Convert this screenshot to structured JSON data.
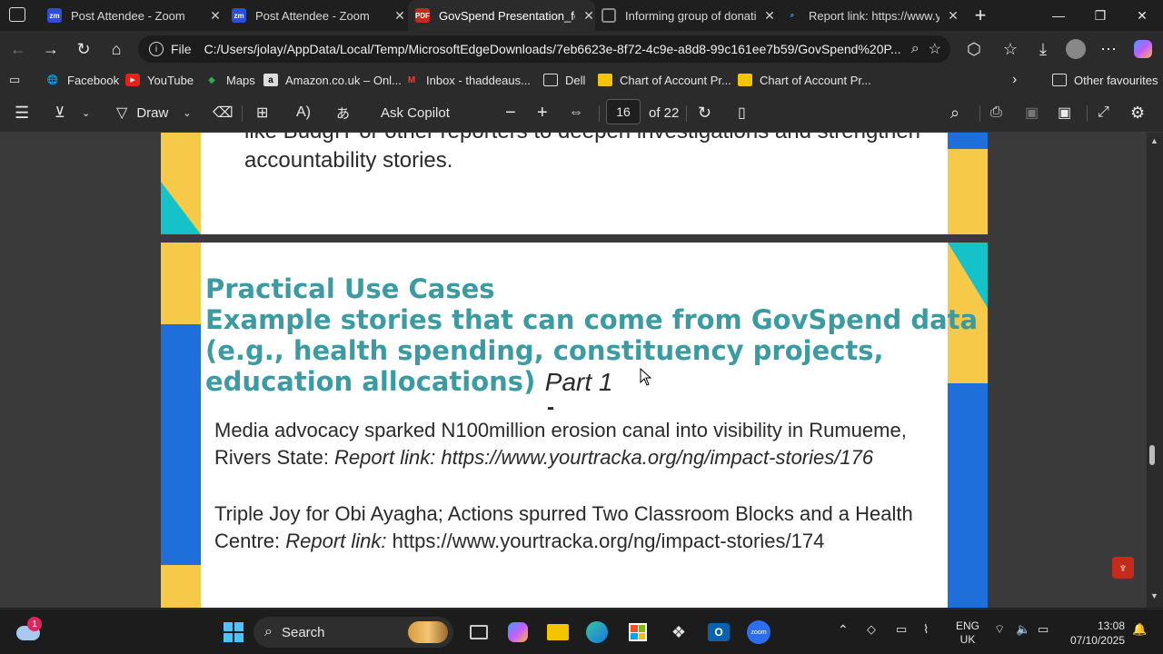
{
  "tabs": [
    {
      "label": "Post Attendee - Zoom",
      "icon": "zoom-icon",
      "active": false
    },
    {
      "label": "Post Attendee - Zoom",
      "icon": "zoom-icon",
      "active": false
    },
    {
      "label": "GovSpend Presentation_fc",
      "icon": "pdf-icon",
      "active": true
    },
    {
      "label": "Informing group of donati",
      "icon": "web-icon",
      "active": false
    },
    {
      "label": "Report link: https://www.yc",
      "icon": "search-icon",
      "active": false
    }
  ],
  "address": {
    "label": "File",
    "url": "C:/Users/jolay/AppData/Local/Temp/MicrosoftEdgeDownloads/7eb6623e-8f72-4c9e-a8d8-99c161ee7b59/GovSpend%20P..."
  },
  "favorites": [
    {
      "label": "Facebook",
      "icon": "facebook-icon"
    },
    {
      "label": "YouTube",
      "icon": "youtube-icon"
    },
    {
      "label": "Maps",
      "icon": "maps-icon"
    },
    {
      "label": "Amazon.co.uk – Onl...",
      "icon": "amazon-icon"
    },
    {
      "label": "Inbox - thaddeaus...",
      "icon": "gmail-icon"
    },
    {
      "label": "Dell",
      "icon": "folder-icon"
    },
    {
      "label": "Chart of Account Pr...",
      "icon": "sheet-icon"
    },
    {
      "label": "Chart of Account Pr...",
      "icon": "sheet-icon"
    },
    {
      "label": "Other favourites",
      "icon": "folder-icon"
    }
  ],
  "pdf_toolbar": {
    "draw_label": "Draw",
    "copilot_label": "Ask Copilot",
    "page_number": "16",
    "page_total": "of 22"
  },
  "slide1": {
    "line1": "like BudgIT or other reporters to deepen investigations and strengthen",
    "line2": "accountability stories."
  },
  "slide2": {
    "heading1": "Practical Use Cases",
    "heading2": "Example stories that can come from GovSpend data",
    "heading3": "(e.g., health spending, constituency projects,",
    "heading4": "education allocations)",
    "part": "Part 1",
    "dash": "-",
    "item1_line1": "Media advocacy sparked N100million erosion canal into visibility in Rumueme,",
    "item1_prefix": "Rivers State: ",
    "item1_link": "Report link: https://www.yourtracka.org/ng/impact-stories/176",
    "item2_line1": "Triple Joy for Obi Ayagha; Actions spurred Two Classroom Blocks and a Health",
    "item2_prefix": "Centre: ",
    "item2_link_label": "Report link: ",
    "item2_link": "https://www.yourtracka.org/ng/impact-stories/174"
  },
  "taskbar": {
    "search_label": "Search",
    "weather_badge": "1",
    "lang1": "ENG",
    "lang2": "UK",
    "time": "13:08",
    "date": "07/10/2025"
  },
  "colors": {
    "heading": "#3a9ca2",
    "accent_yellow": "#f7c948",
    "accent_blue": "#1e6fd9",
    "accent_cyan": "#15c2c9"
  }
}
